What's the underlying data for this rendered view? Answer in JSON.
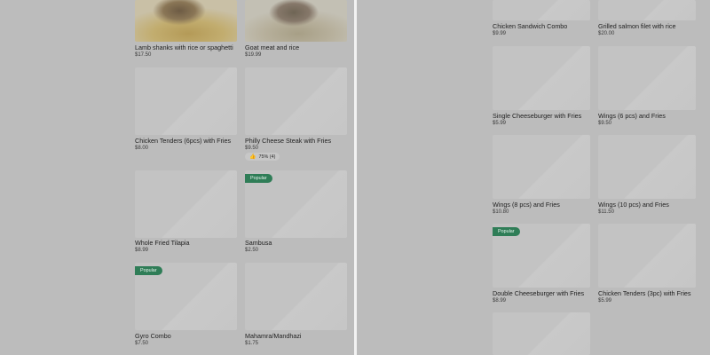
{
  "left_pane": {
    "items": [
      {
        "name": "Lamb shanks with rice or spaghetti",
        "price": "$17.50"
      },
      {
        "name": "Goat meat and rice",
        "price": "$19.99"
      },
      {
        "name": "Chicken Tenders (6pcs) with Fries",
        "price": "$8.00"
      },
      {
        "name": "Philly Cheese Steak with Fries",
        "price": "$9.50",
        "rating": "75% (4)"
      },
      {
        "name": "Whole Fried Tilapia",
        "price": "$8.99"
      },
      {
        "name": "Sambusa",
        "price": "$2.50",
        "badge": "Popular"
      },
      {
        "name": "Gyro Combo",
        "price": "$7.50",
        "badge": "Popular"
      },
      {
        "name": "Mahamra/Mandhazi",
        "price": "$1.75"
      }
    ]
  },
  "right_pane": {
    "items": [
      {
        "name": "Chicken Sandwich Combo",
        "price": "$9.99"
      },
      {
        "name": "Grilled salmon filet with rice",
        "price": "$20.00"
      },
      {
        "name": "Single Cheeseburger with Fries",
        "price": "$5.99"
      },
      {
        "name": "Wings (6 pcs) and Fries",
        "price": "$9.50"
      },
      {
        "name": "Wings (8 pcs) and Fries",
        "price": "$10.80"
      },
      {
        "name": "Wings (10 pcs) and Fries",
        "price": "$11.50"
      },
      {
        "name": "Double Cheeseburger with Fries",
        "price": "$8.99",
        "badge": "Popular"
      },
      {
        "name": "Chicken Tenders (3pc) with Fries",
        "price": "$5.99"
      }
    ]
  },
  "icons": {
    "rating": "thumbs-up-icon"
  },
  "colors": {
    "badge": "#2f7d57",
    "background": "#bcbcbc"
  }
}
